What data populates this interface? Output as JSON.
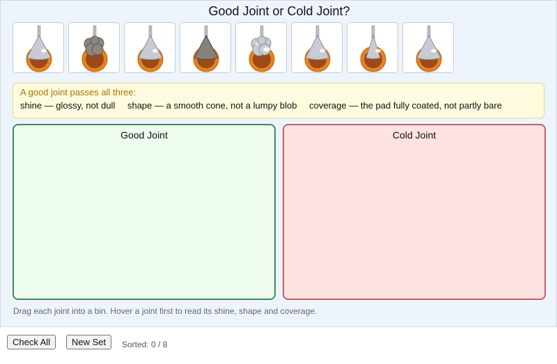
{
  "title": "Good Joint or Cold Joint?",
  "joints": [
    {
      "id": "j1",
      "shine": "glossy",
      "shape": "smooth cone",
      "coverage": "fully coated",
      "color": "#c8ccd2"
    },
    {
      "id": "j2",
      "shine": "dull",
      "shape": "lumpy blob",
      "coverage": "partly bare",
      "color": "#8c8680"
    },
    {
      "id": "j3",
      "shine": "glossy",
      "shape": "smooth cone",
      "coverage": "fully coated",
      "color": "#c8ccd2"
    },
    {
      "id": "j4",
      "shine": "dull",
      "shape": "smooth cone",
      "coverage": "fully coated",
      "color": "#878178"
    },
    {
      "id": "j5",
      "shine": "glossy",
      "shape": "lumpy blob",
      "coverage": "partly bare",
      "color": "#c6ccd4"
    },
    {
      "id": "j6",
      "shine": "glossy",
      "shape": "smooth cone",
      "coverage": "fully coated",
      "color": "#c8ccd2"
    },
    {
      "id": "j7",
      "shine": "glossy",
      "shape": "smooth cone",
      "coverage": "partly bare",
      "color": "#c8ccd2"
    },
    {
      "id": "j8",
      "shine": "glossy",
      "shape": "smooth cone",
      "coverage": "fully coated",
      "color": "#c8ccd2"
    }
  ],
  "hint": {
    "title": "A good joint passes all three:",
    "shine": "shine — glossy, not dull",
    "shape": "shape — a smooth cone, not a lumpy blob",
    "coverage": "coverage — the pad fully coated, not partly bare"
  },
  "bins": {
    "good": {
      "label": "Good Joint",
      "color": "#eefcf0"
    },
    "cold": {
      "label": "Cold Joint",
      "color": "#fde2e1"
    }
  },
  "instructions": "Drag each joint into a bin. Hover a joint first to read its shine, shape and coverage.",
  "controls": {
    "check_label": "Check All",
    "new_label": "New Set",
    "status": "Sorted: 0 / 8"
  }
}
